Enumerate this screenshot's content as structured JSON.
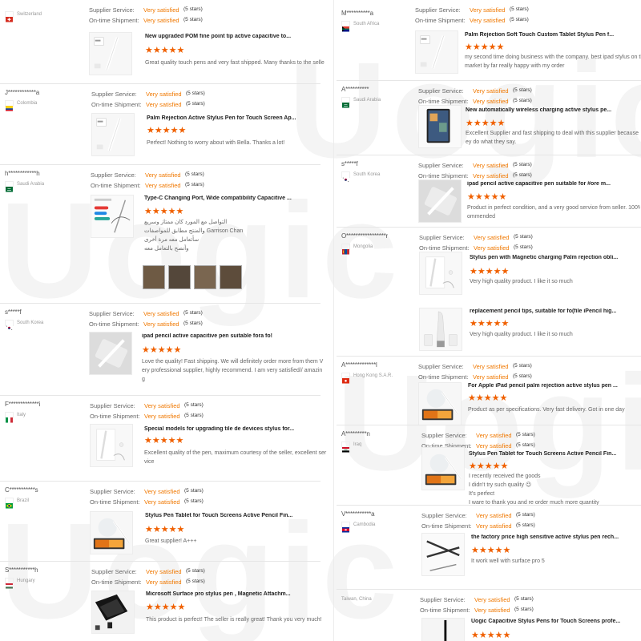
{
  "watermark_text": "Uogic",
  "labels": {
    "supplier": "Supplier Service:",
    "shipment": "On-time Shipment:"
  },
  "stars_glyph": "★★★★★",
  "colors": {
    "accent": "#f06000",
    "rating": "#f07800"
  },
  "left_reviews": [
    {
      "buyer": "",
      "country": "Switzerland",
      "flag": "switzerland",
      "supplier_value": "Very satisfied",
      "supplier_stars": "(5 stars)",
      "shipment_value": "Very satisfied",
      "shipment_stars": "(5 stars)",
      "product": "New upgraded POM fine point tip active capacitive to...",
      "comment": [
        "Great quality touch pens and very fast shipped. Many thanks to the selle"
      ],
      "thumb": "pen-box"
    },
    {
      "buyer": "J************a",
      "country": "Colombia",
      "flag": "colombia",
      "supplier_value": "Very satisfied",
      "supplier_stars": "(5 stars)",
      "shipment_value": "Very satisfied",
      "shipment_stars": "(5 stars)",
      "product": "Palm Rejection Active Stylus Pen for Touch Screen Ap...",
      "comment": [
        "Perfect! Nothing to worry about with Bella. Thanks a lot!"
      ],
      "thumb": "pen-box"
    },
    {
      "buyer": "h************h",
      "country": "Saudi Arabia",
      "flag": "saudi",
      "supplier_value": "Very satisfied",
      "supplier_stars": "(5 stars)",
      "shipment_value": "Very satisfied",
      "shipment_stars": "(5 stars)",
      "product": "Type-C Changing Port, Wide compatibility Capacitive ...",
      "comment": [
        "التواصل مع المورد كان ممتاز وسريع",
        "والمنتج مطابق للمواصفات Garrison Chan",
        "سأتعامل معه مرة أخرى",
        "وأنصح بالتعامل معه"
      ],
      "thumb": "colors",
      "photo_count": 4
    },
    {
      "buyer": "s*****f",
      "country": "South Korea",
      "flag": "korea",
      "supplier_value": "Very satisfied",
      "supplier_stars": "(5 stars)",
      "shipment_value": "Very satisfied",
      "shipment_stars": "(5 stars)",
      "product": "ipad pencil active capacitive pen suitable fora fo!",
      "comment": [
        "Love the quality! Fast shipping. We will definitely order more from them V",
        "ery professional supplier, highly recommend. I am very satisfied// amazin",
        "g"
      ],
      "thumb": "pen-white"
    },
    {
      "buyer": "F*************i",
      "country": "Italy",
      "flag": "italy",
      "supplier_value": "Very satisfied",
      "supplier_stars": "(5 stars)",
      "shipment_value": "Very satisfied",
      "shipment_stars": "(5 stars)",
      "product": "Special models for upgrading tile de devices stylus for...",
      "comment": [
        "Excellent quality of the pen, maximum courtesy of the seller, excellent ser",
        "vice"
      ],
      "thumb": "pen-cable"
    },
    {
      "buyer": "C***********s",
      "country": "Brazil",
      "flag": "brazil",
      "supplier_value": "Very satisfied",
      "supplier_stars": "(5 stars)",
      "shipment_value": "Very satisfied",
      "shipment_stars": "(5 stars)",
      "product": "Stylus Pen Tablet for Touch Screens Active Pencil Fin...",
      "comment": [
        "Great supplier! A+++"
      ],
      "thumb": "tablet"
    },
    {
      "buyer": "S***********h",
      "country": "Hungary",
      "flag": "hungary",
      "supplier_value": "Very satisfied",
      "supplier_stars": "(5 stars)",
      "shipment_value": "Very satisfied",
      "shipment_stars": "(5 stars)",
      "product": "Microsoft Surface pro stylus pen , Magnetic Attachm...",
      "comment": [
        "This product is perfect! The seller is really great! Thank you very much!"
      ],
      "thumb": "surface"
    }
  ],
  "right_reviews": [
    {
      "buyer": "M**********a",
      "country": "South Africa",
      "flag": "southafrica",
      "supplier_value": "Very satisfied",
      "supplier_stars": "(5 stars)",
      "shipment_value": "Very satisfied",
      "shipment_stars": "(5 stars)",
      "product": "Palm Rejection Soft Touch Custom Tablet Stylus Pen f...",
      "comment": [
        "my second time doing business with the company. best ipad stylus on the",
        "market by far really happy with my order"
      ],
      "thumb": "pen-box"
    },
    {
      "buyer": "A**********",
      "country": "Saudi Arabia",
      "flag": "saudi",
      "supplier_value": "Very satisfied",
      "supplier_stars": "(5 stars)",
      "shipment_value": "Very satisfied",
      "shipment_stars": "(5 stars)",
      "product": "New automatically wireless charging active stylus pe...",
      "comment": [
        "Excellent Supplier and fast shipping to  deal with this supplier because th",
        "ey do what they say."
      ],
      "thumb": "ipad"
    },
    {
      "buyer": "s*****f",
      "country": "South Korea",
      "flag": "korea",
      "supplier_value": "Very satisfied",
      "supplier_stars": "(5 stars)",
      "shipment_value": "Very satisfied",
      "shipment_stars": "(5 stars)",
      "product": "ipad pencil active capacitive pen suitable for #ore m...",
      "comment": [
        "Product in perfect condition, and a very good service from seller. 100% rec",
        "ommended"
      ],
      "thumb": "pen-white"
    },
    {
      "buyer": "O*****************r",
      "country": "Mongolia",
      "flag": "mongolia",
      "supplier_value": "Very satisfied",
      "supplier_stars": "(5 stars)",
      "shipment_value": "Very satisfied",
      "shipment_stars": "(5 stars)",
      "product": "Stylus pen with Magnetic charging Palm rejection obli...",
      "comment": [
        "Very high quality product. I like it so much"
      ],
      "thumb": "pen-cable"
    },
    {
      "buyer": "",
      "country": "",
      "flag": "",
      "supplier_value": "",
      "supplier_stars": "",
      "shipment_value": "",
      "shipment_stars": "",
      "product": "replacement pencil tips, suitable for fo(file iPencil hig...",
      "comment": [
        "Very high quality product. I like it so much"
      ],
      "thumb": "tips"
    },
    {
      "buyer": "A*************l",
      "country": "Hong Kong S.A.R.",
      "flag": "hongkong",
      "supplier_value": "Very satisfied",
      "supplier_stars": "(5 stars)",
      "shipment_value": "Very satisfied",
      "shipment_stars": "(5 stars)",
      "product": "For Apple iPad pencil palm rejection active stylus pen ...",
      "comment": [
        "Product as per specifications. Very fast delivery. Got in one day"
      ],
      "thumb": "tablet"
    },
    {
      "buyer": "A*********n",
      "country": "Iraq",
      "flag": "iraq",
      "supplier_value": "Very satisfied",
      "supplier_stars": "(5 stars)",
      "shipment_value": "Very satisfied",
      "shipment_stars": "(5 stars)",
      "product": "Stylus Pen Tablet for Touch Screens Active Pencil Fin...",
      "comment": [
        "I recently received the goods",
        "I didn't try such quality 😉",
        "It's perfect",
        "I ware to thank you and re order much more quantity"
      ],
      "thumb": "tablet"
    },
    {
      "buyer": "V***********a",
      "country": "Cambodia",
      "flag": "cambodia",
      "supplier_value": "Very satisfied",
      "supplier_stars": "(5 stars)",
      "shipment_value": "Very satisfied",
      "shipment_stars": "(5 stars)",
      "product": "the factory price high sensitive active stylus pen rech...",
      "comment": [
        "It work well with surface pro 5"
      ],
      "thumb": "surface-pen"
    },
    {
      "buyer": "",
      "country": "Taiwan, China",
      "flag": "",
      "supplier_value": "Very satisfied",
      "supplier_stars": "(5 stars)",
      "shipment_value": "Very satisfied",
      "shipment_stars": "(5 stars)",
      "product": "Uogic Capacitive Stylus Pens for Touch Screens profe...",
      "comment": [],
      "thumb": "black-pen"
    }
  ]
}
